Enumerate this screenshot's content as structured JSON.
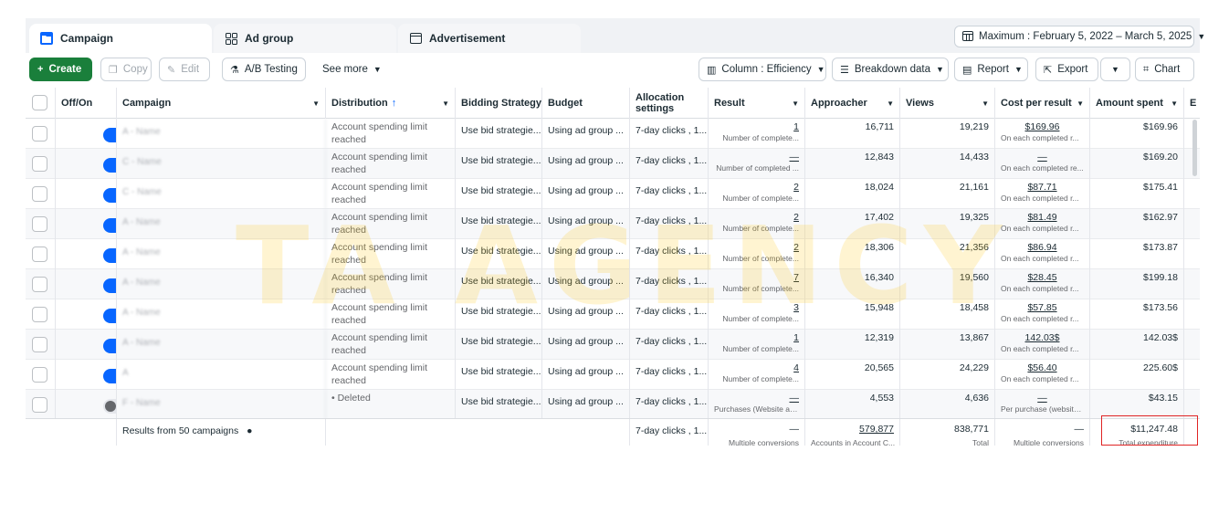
{
  "tabs": [
    {
      "label": "Campaign",
      "icon": "folder-icon",
      "active": true
    },
    {
      "label": "Ad group",
      "icon": "grid-icon",
      "active": false
    },
    {
      "label": "Advertisement",
      "icon": "ad-icon",
      "active": false
    }
  ],
  "date_range": "Maximum : February 5, 2022 – March 5, 2025",
  "toolbar": {
    "create": "Create",
    "copy": "Copy",
    "edit": "Edit",
    "ab_testing": "A/B Testing",
    "see_more": "See more",
    "column": "Column : Efficiency",
    "breakdown": "Breakdown data",
    "report": "Report",
    "export": "Export",
    "chart": "Chart"
  },
  "columns": {
    "off_on": "Off/On",
    "campaign": "Campaign",
    "distribution": "Distribution",
    "bidding": "Bidding Strategy",
    "budget": "Budget",
    "allocation": "Allocation settings",
    "result": "Result",
    "approacher": "Approacher",
    "views": "Views",
    "cost_per_result": "Cost per result",
    "amount_spent": "Amount spent",
    "extra": "E"
  },
  "rows": [
    {
      "campaign": "A - Name",
      "on": true,
      "distribution": "Account spending limit reached",
      "bidding": "Use bid strategie...",
      "budget": "Using ad group ...",
      "allocation": "7-day clicks , 1...",
      "result": "1",
      "result_sub": "Number of complete...",
      "approacher": "16,711",
      "views": "19,219",
      "cpr": "$169.96",
      "cpr_sub": "On each completed r...",
      "spent": "$169.96"
    },
    {
      "campaign": "C - Name",
      "on": true,
      "distribution": "Account spending limit reached",
      "bidding": "Use bid strategie...",
      "budget": "Using ad group ...",
      "allocation": "7-day clicks , 1...",
      "result": "—",
      "result_sub": "Number of completed ...",
      "approacher": "12,843",
      "views": "14,433",
      "cpr": "—",
      "cpr_sub": "On each completed re...",
      "spent": "$169.20"
    },
    {
      "campaign": "C - Name",
      "on": true,
      "distribution": "Account spending limit reached",
      "bidding": "Use bid strategie...",
      "budget": "Using ad group ...",
      "allocation": "7-day clicks , 1...",
      "result": "2",
      "result_sub": "Number of complete...",
      "approacher": "18,024",
      "views": "21,161",
      "cpr": "$87.71",
      "cpr_sub": "On each completed r...",
      "spent": "$175.41"
    },
    {
      "campaign": "A - Name",
      "on": true,
      "distribution": "Account spending limit reached",
      "bidding": "Use bid strategie...",
      "budget": "Using ad group ...",
      "allocation": "7-day clicks , 1...",
      "result": "2",
      "result_sub": "Number of complete...",
      "approacher": "17,402",
      "views": "19,325",
      "cpr": "$81.49",
      "cpr_sub": "On each completed r...",
      "spent": "$162.97"
    },
    {
      "campaign": "A - Name",
      "on": true,
      "distribution": "Account spending limit reached",
      "bidding": "Use bid strategie...",
      "budget": "Using ad group ...",
      "allocation": "7-day clicks , 1...",
      "result": "2",
      "result_sub": "Number of complete...",
      "approacher": "18,306",
      "views": "21,356",
      "cpr": "$86.94",
      "cpr_sub": "On each completed r...",
      "spent": "$173.87"
    },
    {
      "campaign": "A - Name",
      "on": true,
      "distribution": "Account spending limit reached",
      "bidding": "Use bid strategie...",
      "budget": "Using ad group ...",
      "allocation": "7-day clicks , 1...",
      "result": "7",
      "result_sub": "Number of complete...",
      "approacher": "16,340",
      "views": "19,560",
      "cpr": "$28.45",
      "cpr_sub": "On each completed r...",
      "spent": "$199.18"
    },
    {
      "campaign": "A - Name",
      "on": true,
      "distribution": "Account spending limit reached",
      "bidding": "Use bid strategie...",
      "budget": "Using ad group ...",
      "allocation": "7-day clicks , 1...",
      "result": "3",
      "result_sub": "Number of complete...",
      "approacher": "15,948",
      "views": "18,458",
      "cpr": "$57.85",
      "cpr_sub": "On each completed r...",
      "spent": "$173.56"
    },
    {
      "campaign": "A - Name",
      "on": true,
      "distribution": "Account spending limit reached",
      "bidding": "Use bid strategie...",
      "budget": "Using ad group ...",
      "allocation": "7-day clicks , 1...",
      "result": "1",
      "result_sub": "Number of complete...",
      "approacher": "12,319",
      "views": "13,867",
      "cpr": "142.03$",
      "cpr_sub": "On each completed r...",
      "spent": "142.03$"
    },
    {
      "campaign": "A",
      "on": true,
      "distribution": "Account spending limit reached",
      "bidding": "Use bid strategie...",
      "budget": "Using ad group ...",
      "allocation": "7-day clicks , 1...",
      "result": "4",
      "result_sub": "Number of complete...",
      "approacher": "20,565",
      "views": "24,229",
      "cpr": "$56.40",
      "cpr_sub": "On each completed r...",
      "spent": "225.60$"
    },
    {
      "campaign": "F - Name",
      "on": false,
      "distribution": "• Deleted",
      "bidding": "Use bid strategie...",
      "budget": "Using ad group ...",
      "allocation": "7-day clicks , 1...",
      "result": "—",
      "result_sub": "Purchases (Website an...",
      "approacher": "4,553",
      "views": "4,636",
      "cpr": "—",
      "cpr_sub": "Per purchase (website ...",
      "spent": "$43.15"
    }
  ],
  "totals": {
    "label": "Results from 50 campaigns",
    "allocation": "7-day clicks , 1...",
    "result": "—",
    "result_sub": "Multiple conversions",
    "approacher": "579,877",
    "approacher_sub": "Accounts in Account C...",
    "views": "838,771",
    "views_sub": "Total",
    "cpr": "—",
    "cpr_sub": "Multiple conversions",
    "spent": "$11,247.48",
    "spent_sub": "Total expenditure"
  },
  "watermark": "TA AGENCY",
  "colors": {
    "accent": "#0866ff",
    "create": "#1a7f3b",
    "highlight": "#e02424"
  }
}
